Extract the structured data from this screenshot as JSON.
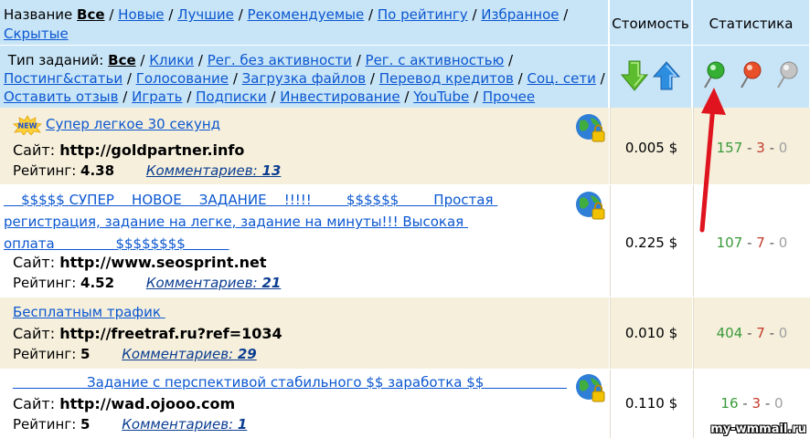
{
  "nav": {
    "label": "Название",
    "items": [
      "Все",
      "Новые",
      "Лучшие",
      "Рекомендуемые",
      "По рейтингу",
      "Избранное",
      "Скрытые"
    ]
  },
  "types": {
    "label": "Тип заданий:",
    "items": [
      "Все",
      "Клики",
      "Рег. без активности",
      "Рег. с активностью",
      "Постинг&статьи",
      "Голосование",
      "Загрузка файлов",
      "Перевод кредитов",
      "Соц. сети",
      "Оставить отзыв",
      "Играть",
      "Подписки",
      "Инвестирование",
      "YouTube",
      "Прочее"
    ]
  },
  "columns": {
    "cost": "Стоимость",
    "stats": "Статистика"
  },
  "icons": {
    "sort_down": "green-down-arrow-icon",
    "sort_up": "blue-up-arrow-icon",
    "pin_green": "green-pin-icon",
    "pin_red": "red-pin-icon",
    "pin_gray": "gray-pin-icon",
    "globe_lock": "globe-lock-icon",
    "new_badge": "new-badge-icon"
  },
  "colors": {
    "header_bg": "#c8e4f7",
    "beige_row": "#f5efdc",
    "link": "#0b57d0",
    "green": "#3a9a3a",
    "red": "#c43a2a",
    "gray": "#a0a0a0",
    "arrow": "#e0141e"
  },
  "tasks": [
    {
      "title": "Супер легкое 30 секунд",
      "site_label": "Сайт:",
      "site": "http://goldpartner.info",
      "rating_label": "Рейтинг:",
      "rating": "4.38",
      "comments_label": "Комментариев:",
      "comments": "13",
      "cost": "0.005 $",
      "stat_green": "157",
      "stat_red": "3",
      "stat_gray": "0"
    },
    {
      "title": "    $$$$$ СУПЕР    НОВОЕ    ЗАДАНИЕ    !!!!!        $$$$$$        Простая регистрация, задание на легке, задание на минуты!!! Высокая оплата              $$$$$$$$          ",
      "site_label": "Сайт:",
      "site": "http://www.seosprint.net",
      "rating_label": "Рейтинг:",
      "rating": "4.52",
      "comments_label": "Комментариев:",
      "comments": "21",
      "cost": "0.225 $",
      "stat_green": "107",
      "stat_red": "7",
      "stat_gray": "0"
    },
    {
      "title": "Бесплатным трафик ",
      "site_label": "Сайт:",
      "site": "http://freetraf.ru?ref=1034",
      "rating_label": "Рейтинг:",
      "rating": "5",
      "comments_label": "Комментариев:",
      "comments": "29",
      "cost": "0.010 $",
      "stat_green": "404",
      "stat_red": "7",
      "stat_gray": "0"
    },
    {
      "title": "                 Задание с перспективой стабильного $$ заработка $$                   ",
      "site_label": "Сайт:",
      "site": "http://wad.ojooo.com",
      "rating_label": "Рейтинг:",
      "rating": "5",
      "comments_label": "Комментариев:",
      "comments": "1",
      "cost": "0.110 $",
      "stat_green": "16",
      "stat_red": "3",
      "stat_gray": "0"
    }
  ],
  "watermark": "my-wmmail.ru"
}
